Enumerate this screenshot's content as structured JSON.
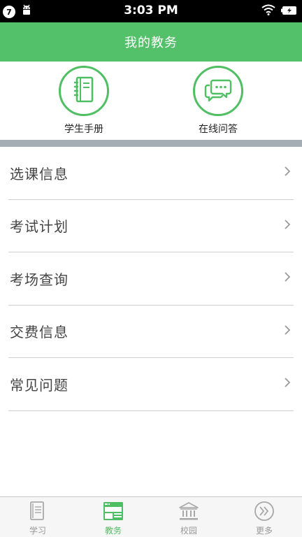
{
  "status_bar": {
    "badge": "7",
    "time": "3:03 PM"
  },
  "header": {
    "title": "我的教务"
  },
  "quick_actions": [
    {
      "label": "学生手册",
      "icon": "notebook-icon"
    },
    {
      "label": "在线问答",
      "icon": "chat-bubbles-icon"
    }
  ],
  "menu": {
    "items": [
      {
        "label": "选课信息"
      },
      {
        "label": "考试计划"
      },
      {
        "label": "考场查询"
      },
      {
        "label": "交费信息"
      },
      {
        "label": "常见问题"
      }
    ]
  },
  "tabbar": {
    "items": [
      {
        "label": "学习",
        "icon": "document-icon",
        "active": false
      },
      {
        "label": "教务",
        "icon": "newspaper-icon",
        "active": true
      },
      {
        "label": "校园",
        "icon": "building-icon",
        "active": false
      },
      {
        "label": "更多",
        "icon": "double-chevron-icon",
        "active": false
      }
    ]
  },
  "colors": {
    "brand_green": "#53c16a",
    "accent_green": "#4fbf63",
    "divider_band": "#a4adb4",
    "inactive_gray": "#999999"
  }
}
